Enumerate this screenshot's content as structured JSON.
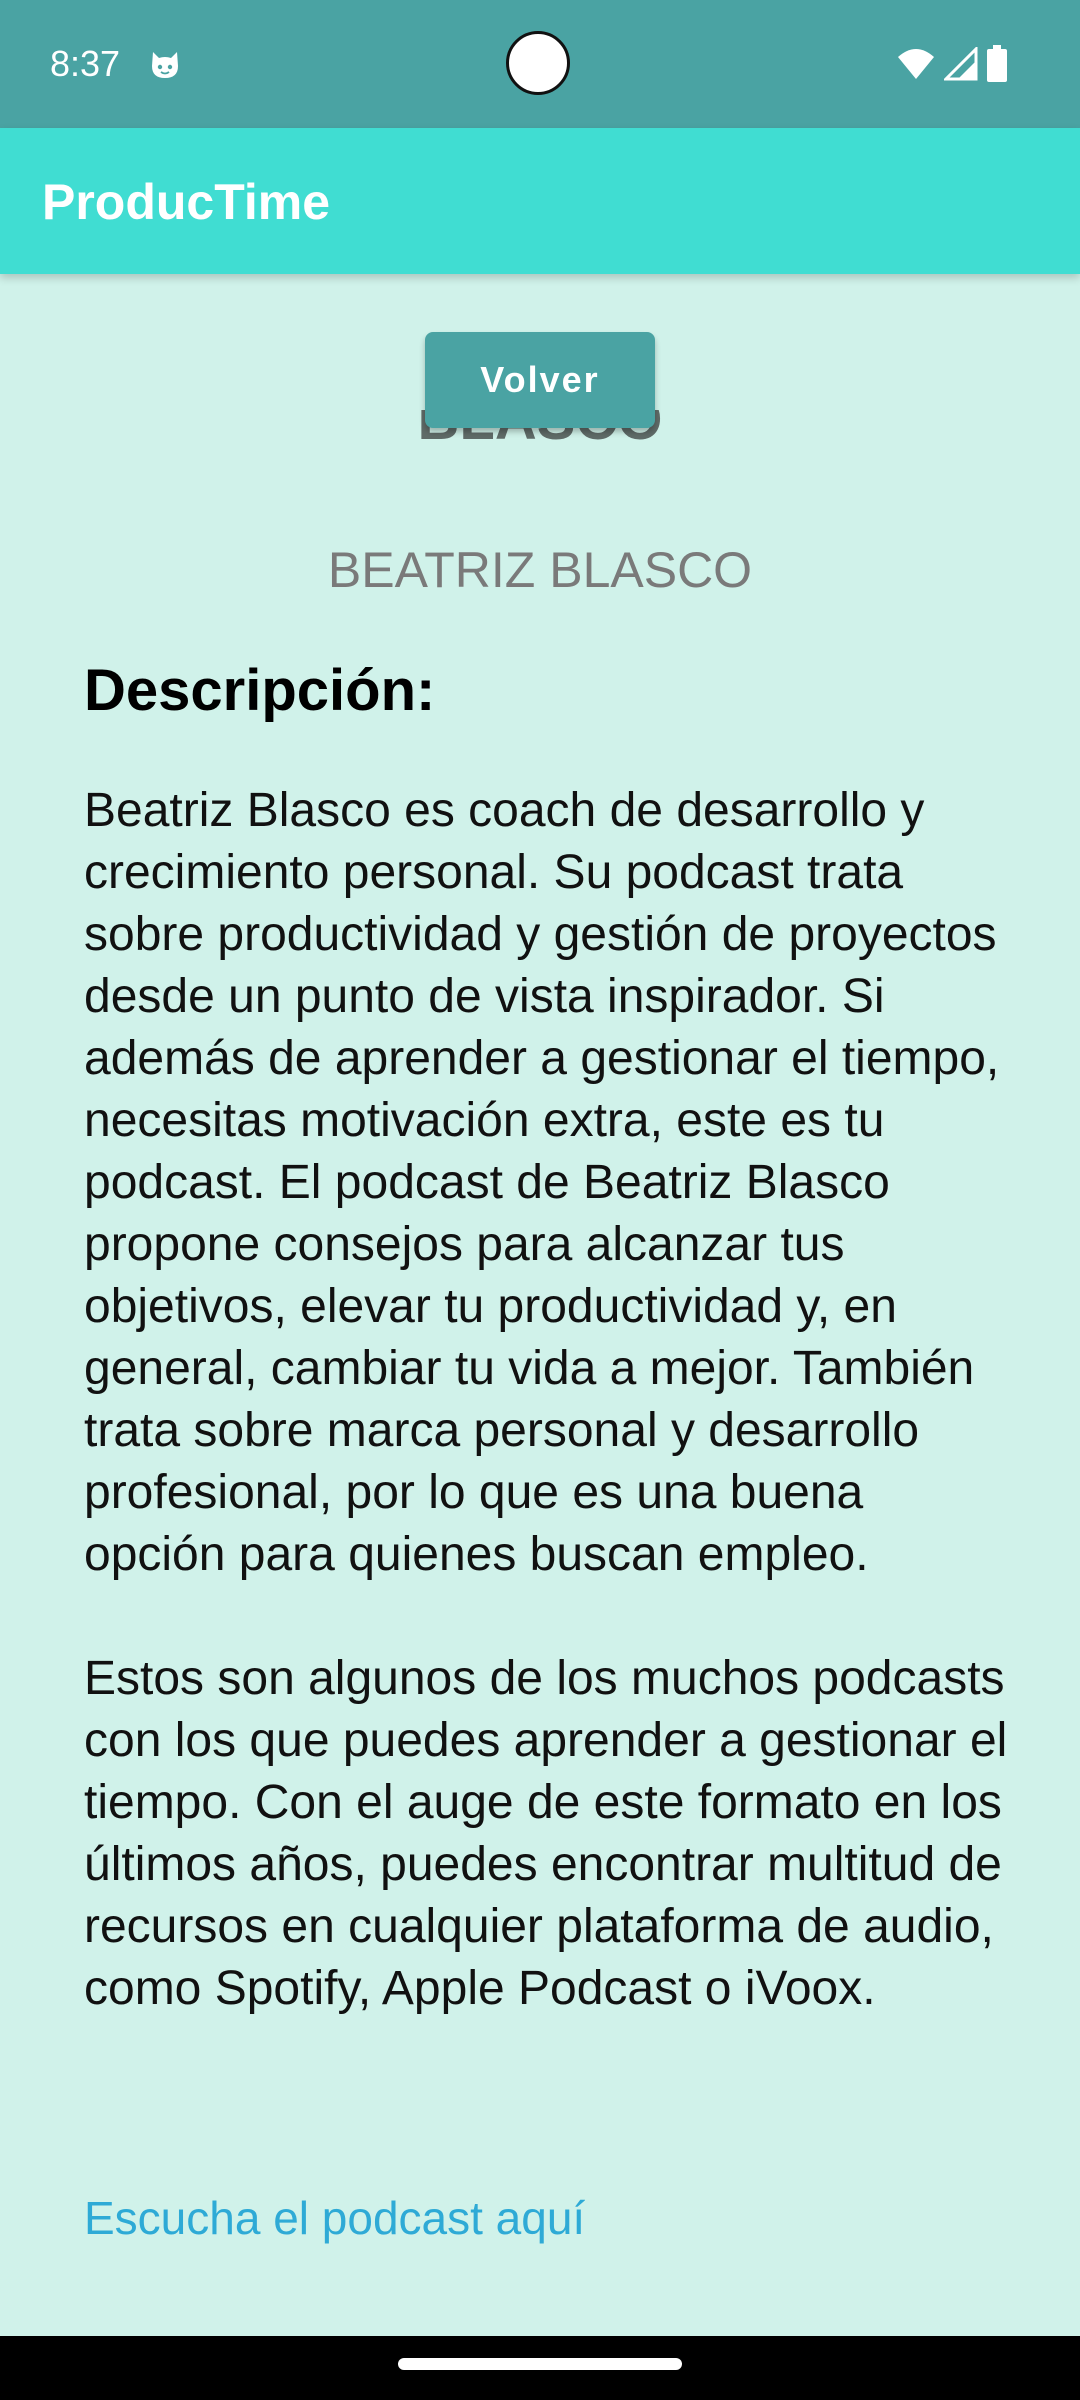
{
  "status_bar": {
    "time": "8:37",
    "icons": [
      "cat-icon",
      "wifi-icon",
      "signal-icon",
      "battery-icon"
    ]
  },
  "app_bar": {
    "title": "ProducTime"
  },
  "detail": {
    "back_button_label": "Volver",
    "title": "BLASCO",
    "author": "BEATRIZ BLASCO",
    "description_heading": "Descripción:",
    "description": "Beatriz Blasco es coach de desarrollo y crecimiento personal. Su podcast trata sobre productividad y gestión de proyectos desde un punto de vista inspirador. Si además de aprender a gestionar el tiempo, necesitas motivación extra, este es tu podcast. El podcast de Beatriz Blasco propone consejos para alcanzar tus objetivos, elevar tu productividad y, en general, cambiar tu vida a mejor. También trata sobre marca personal y desarrollo profesional, por lo que es una buena opción para quienes buscan empleo.\n\nEstos son algunos de los muchos podcasts con los que puedes aprender a gestionar el tiempo. Con el auge de este formato en los últimos años, puedes encontrar multitud de recursos en cualquier plataforma de audio, como Spotify, Apple Podcast o iVoox.",
    "link_label": "Escucha el podcast aquí"
  },
  "colors": {
    "status_bar": "#4aa3a3",
    "app_bar": "#40ddd2",
    "background": "#d0f2ea",
    "button": "#4aa3a3",
    "link": "#2eaad6"
  }
}
